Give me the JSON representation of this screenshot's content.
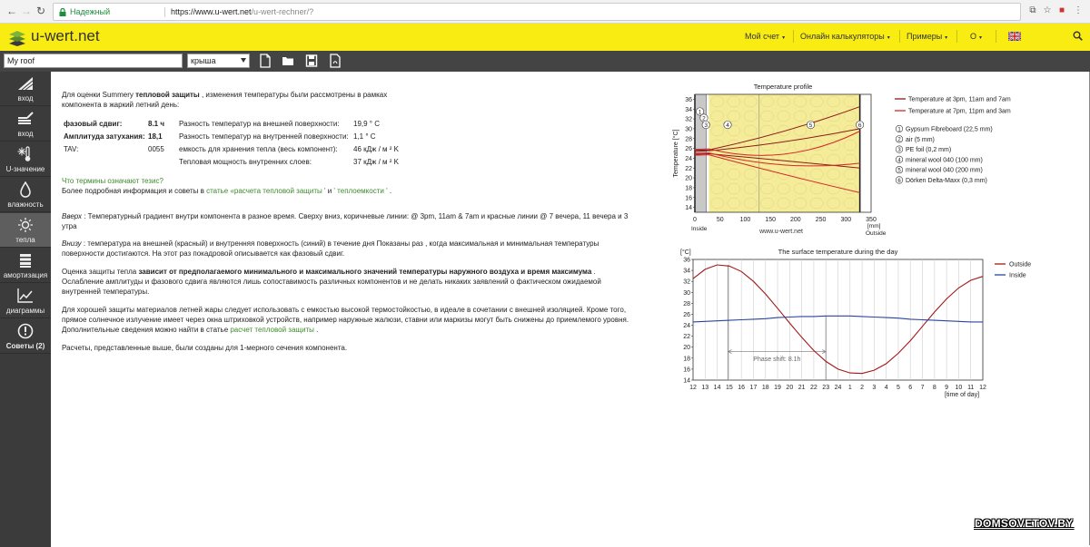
{
  "browser": {
    "secure_label": "Надежный",
    "url_host": "https://www.u-wert.net",
    "url_path": "/u-wert-rechner/?"
  },
  "header": {
    "logo": "u-wert.net",
    "menu": [
      {
        "label": "Мой счет"
      },
      {
        "label": "Онлайн калькуляторы"
      },
      {
        "label": "Примеры"
      },
      {
        "label": "О"
      }
    ]
  },
  "toolbar": {
    "project_name": "My roof",
    "component_type": "крыша"
  },
  "sidebar": {
    "items": [
      {
        "label": "вход",
        "icon": "roof-layers-icon"
      },
      {
        "label": "вход",
        "icon": "layers-edit-icon"
      },
      {
        "label": "U-значение",
        "icon": "thermometer-snow-icon"
      },
      {
        "label": "влажность",
        "icon": "drop-icon"
      },
      {
        "label": "тепла",
        "icon": "sun-icon"
      },
      {
        "label": "амортизация",
        "icon": "stack-icon"
      },
      {
        "label": "диаграммы",
        "icon": "chart-icon"
      },
      {
        "label": "Советы (2)",
        "icon": "alert-icon"
      }
    ]
  },
  "main": {
    "intro_1": "Для оценки Summery ",
    "intro_bold": "тепловой защиты",
    "intro_2": " , изменения температуры были рассмотрены в рамках",
    "intro_3": "компонента в жаркий летний день:",
    "results": {
      "phase_label": "фазовый сдвиг:",
      "phase_value": "8.1 ч",
      "ampl_label": "Амплитуда затухания:",
      "ampl_value": "18,1",
      "tav_label": "TAV:",
      "tav_value": "0055",
      "outer_label": "Разность температур на внешней поверхности:",
      "outer_value": "19,9 ° C",
      "inner_label": "Разность температур на внутренней поверхности:",
      "inner_value": "1,1 ° C",
      "capacity_label": "емкость для хранения тепла (весь компонент):",
      "capacity_value": "46 кДж / м ² K",
      "inner_cap_label": "Тепловая мощность внутренних слоев:",
      "inner_cap_value": "37 кДж / м ² K"
    },
    "question_link": "Что термины означают тезис?",
    "more_info_1": "Более подробная информация и советы в ",
    "more_info_link1": "статье «расчета тепловой защиты '",
    "more_info_and": " и ",
    "more_info_link2": "' теплоемкости '",
    "more_info_end": " .",
    "top_label": "Вверх",
    "top_text": " : Температурный градиент внутри компонента в разное время. Сверху вниз, коричневые линии: @ 3pm, 11am & 7am и красные линии @ 7 вечера, 11 вечера и 3",
    "top_text_2": "утра",
    "bottom_label": "Внизу",
    "bottom_text": " : температура на внешней (красный) и внутренняя поверхность (синий) в течение дня Показаны раз , когда максимальная и минимальная температуры",
    "bottom_text_2": "поверхности достигаются. На этот раз покадровой описывается как фазовый сдвиг.",
    "eval_1": "Оценка защиты тепла ",
    "eval_bold": "зависит от предполагаемого минимального и максимального значений температуры наружного воздуха и время максимума",
    "eval_end": " .",
    "eval_2": "Ослабление амплитуды и фазового сдвига являются лишь сопоставимость различных компонентов и не делать никаких заявлений о фактическом ожидаемой",
    "eval_3": "внутренней температуры.",
    "good_1": "Для хорошей защиты материалов летней жары следует использовать с емкостью высокой термостойкостью, в идеале в сочетании с внешней изоляцией. Кроме того,",
    "good_2": "прямое солнечное излучение имеет через окна штриховкой устройств, например наружные жалюзи, ставни или маркизы могут быть снижены до приемлемого уровня.",
    "good_3": "Дополнительные сведения можно найти в статье ",
    "good_link": "расчет тепловой защиты",
    "good_end": " .",
    "calc_note": "Расчеты, представленные выше, были созданы для 1-мерного сечения компонента."
  },
  "profile_chart": {
    "title": "Temperature profile",
    "ylabel": "Temperature [°C]",
    "xlabel": "[mm]",
    "inside": "Inside",
    "outside": "Outside",
    "credit": "www.u-wert.net",
    "yticks": [
      "36",
      "34",
      "32",
      "30",
      "28",
      "26",
      "24",
      "22",
      "20",
      "18",
      "16",
      "14"
    ],
    "xticks": [
      "0",
      "50",
      "100",
      "150",
      "200",
      "250",
      "300",
      "350"
    ],
    "legend_lines": [
      {
        "label": "Temperature at 3pm, 11am and 7am",
        "color": "#8b1a1a"
      },
      {
        "label": "Temperature at 7pm, 11pm and 3am",
        "color": "#d42a2a"
      }
    ],
    "layers": [
      {
        "num": "1",
        "label": "Gypsum Fibreboard (22,5 mm)"
      },
      {
        "num": "2",
        "label": "air (5 mm)"
      },
      {
        "num": "3",
        "label": "PE foil (0,2 mm)"
      },
      {
        "num": "4",
        "label": "mineral wool 040 (100 mm)"
      },
      {
        "num": "5",
        "label": "mineral wool 040 (200 mm)"
      },
      {
        "num": "6",
        "label": "Dörken Delta-Maxx (0,3 mm)"
      }
    ]
  },
  "chart_data": {
    "type": "line",
    "title": "The surface temperature during the day",
    "ylabel": "[°C]",
    "xlabel": "[time of day]",
    "categories": [
      "12",
      "13",
      "14",
      "15",
      "16",
      "17",
      "18",
      "19",
      "20",
      "21",
      "22",
      "23",
      "24",
      "1",
      "2",
      "3",
      "4",
      "5",
      "6",
      "7",
      "8",
      "9",
      "10",
      "11",
      "12"
    ],
    "ylim": [
      14,
      36
    ],
    "yticks": [
      "36",
      "34",
      "32",
      "30",
      "28",
      "26",
      "24",
      "22",
      "20",
      "18",
      "16",
      "14"
    ],
    "annotation": "Phase shift: 8.1h",
    "series": [
      {
        "name": "Outside",
        "color": "#a01818",
        "values": [
          32.5,
          34.2,
          35.0,
          34.8,
          33.8,
          32.0,
          29.7,
          27.1,
          24.4,
          21.8,
          19.4,
          17.4,
          16.0,
          15.3,
          15.2,
          15.8,
          17.0,
          18.9,
          21.2,
          23.8,
          26.4,
          28.8,
          30.8,
          32.2,
          32.9
        ]
      },
      {
        "name": "Inside",
        "color": "#2a44a0",
        "values": [
          24.6,
          24.7,
          24.8,
          24.9,
          25.0,
          25.1,
          25.2,
          25.4,
          25.5,
          25.6,
          25.6,
          25.7,
          25.7,
          25.7,
          25.6,
          25.5,
          25.4,
          25.3,
          25.1,
          25.0,
          24.9,
          24.8,
          24.7,
          24.6,
          24.6
        ]
      }
    ]
  },
  "watermark": "DOMSOVETOV.BY"
}
